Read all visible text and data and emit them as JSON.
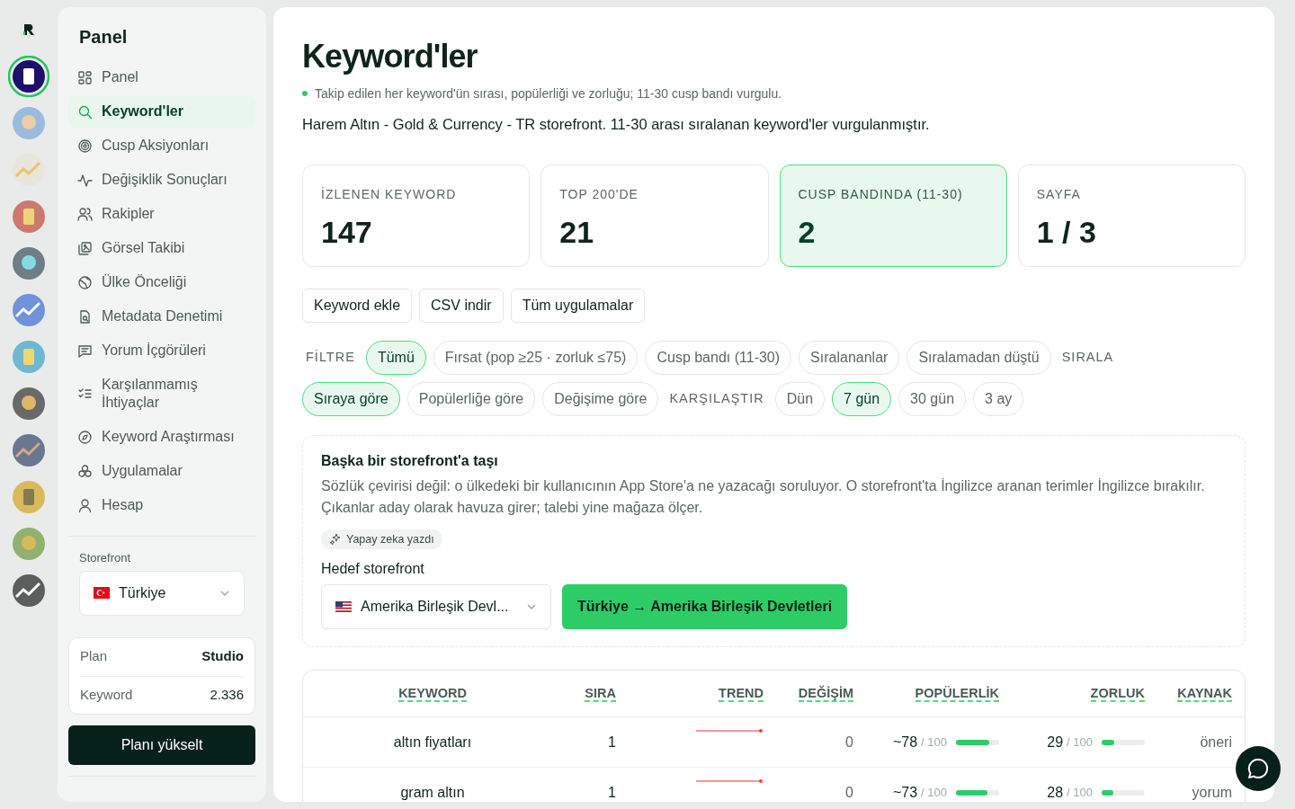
{
  "apps": [
    {
      "selected": true
    },
    {
      "selected": false
    },
    {
      "selected": false
    },
    {
      "selected": false
    },
    {
      "selected": false
    },
    {
      "selected": false
    },
    {
      "selected": false
    },
    {
      "selected": false
    },
    {
      "selected": false
    },
    {
      "selected": false
    },
    {
      "selected": false
    },
    {
      "selected": false
    }
  ],
  "sidebar": {
    "title": "Panel",
    "items": [
      {
        "label": "Panel",
        "selected": false
      },
      {
        "label": "Keyword'ler",
        "selected": true
      },
      {
        "label": "Cusp Aksiyonları",
        "selected": false
      },
      {
        "label": "Değişiklik Sonuçları",
        "selected": false
      },
      {
        "label": "Rakipler",
        "selected": false
      },
      {
        "label": "Görsel Takibi",
        "selected": false
      },
      {
        "label": "Ülke Önceliği",
        "selected": false
      },
      {
        "label": "Metadata Denetimi",
        "selected": false
      },
      {
        "label": "Yorum İçgörüleri",
        "selected": false
      },
      {
        "label": "Karşılanmamış İhtiyaçlar",
        "selected": false
      },
      {
        "label": "Keyword Araştırması",
        "selected": false
      },
      {
        "label": "Uygulamalar",
        "selected": false
      },
      {
        "label": "Hesap",
        "selected": false
      }
    ],
    "storefront_label": "Storefront",
    "storefront": "Türkiye",
    "plan": [
      {
        "label": "Plan",
        "value": "Studio"
      },
      {
        "label": "Keyword",
        "value": "2.336"
      }
    ],
    "upgrade_button": "Planı yükselt"
  },
  "page": {
    "title": "Keyword'ler",
    "hint": "Takip edilen her keyword'ün sırası, popülerliği ve zorluğu; 11-30 cusp bandı vurgulu.",
    "subtitle": "Harem Altın - Gold & Currency - TR storefront. 11-30 arası sıralanan keyword'ler vurgulanmıştır."
  },
  "stats": [
    {
      "label": "İZLENEN KEYWORD",
      "value": "147",
      "selected": false
    },
    {
      "label": "TOP 200'DE",
      "value": "21",
      "selected": false
    },
    {
      "label": "CUSP BANDINDA (11-30)",
      "value": "2",
      "selected": true
    },
    {
      "label": "SAYFA",
      "value": "1 / 3",
      "selected": false
    }
  ],
  "actions": [
    "Keyword ekle",
    "CSV indir",
    "Tüm uygulamalar"
  ],
  "chip_rows": [
    {
      "kind": "label",
      "text": "FİLTRE"
    },
    {
      "kind": "chip",
      "text": "Tümü",
      "selected": true
    },
    {
      "kind": "chip",
      "text": "Fırsat (pop ≥25 · zorluk ≤75)",
      "selected": false
    },
    {
      "kind": "chip",
      "text": "Cusp bandı (11-30)",
      "selected": false
    },
    {
      "kind": "chip",
      "text": "Sıralananlar",
      "selected": false
    },
    {
      "kind": "chip",
      "text": "Sıralamadan düştü",
      "selected": false
    },
    {
      "kind": "label",
      "text": "SIRALA"
    },
    {
      "kind": "chip",
      "text": "Sıraya göre",
      "selected": true
    },
    {
      "kind": "chip",
      "text": "Popülerliğe göre",
      "selected": false
    },
    {
      "kind": "chip",
      "text": "Değişime göre",
      "selected": false
    },
    {
      "kind": "label",
      "text": "KARŞILAŞTIR"
    },
    {
      "kind": "chip",
      "text": "Dün",
      "selected": false
    },
    {
      "kind": "chip",
      "text": "7 gün",
      "selected": true
    },
    {
      "kind": "chip",
      "text": "30 gün",
      "selected": false
    },
    {
      "kind": "chip",
      "text": "3 ay",
      "selected": false
    }
  ],
  "move_card": {
    "title": "Başka bir storefront'a taşı",
    "text": "Sözlük çevirisi değil: o ülkedeki bir kullanıcının App Store'a ne yazacağı soruluyor. O storefront'ta İngilizce aranan terimler İngilizce bırakılır. Çıkanlar aday olarak havuza girer; talebi yine mağaza ölçer.",
    "ai_badge": "Yapay zeka yazdı",
    "target_label": "Hedef storefront",
    "target": "Amerika Birleşik Devl...",
    "move_button": "Türkiye → Amerika Birleşik Devletleri"
  },
  "table": {
    "columns": [
      "KEYWORD",
      "SIRA",
      "TREND",
      "DEĞİŞİM",
      "POPÜLERLİK",
      "ZORLUK",
      "KAYNAK"
    ],
    "rows": [
      {
        "keyword": "altın fiyatları",
        "rank": "1",
        "change": "0",
        "popularity": "~78",
        "popularity_max": "/ 100",
        "popularity_bar": {
          "level": 0.78
        },
        "difficulty": "29",
        "difficulty_max": "/ 100",
        "difficulty_bar": {
          "level": 0.29
        },
        "source": "öneri"
      },
      {
        "keyword": "gram altın",
        "rank": "1",
        "change": "0",
        "popularity": "~73",
        "popularity_max": "/ 100",
        "popularity_bar": {
          "level": 0.73
        },
        "difficulty": "28",
        "difficulty_max": "/ 100",
        "difficulty_bar": {
          "level": 0.28
        },
        "source": "yorum"
      }
    ]
  }
}
